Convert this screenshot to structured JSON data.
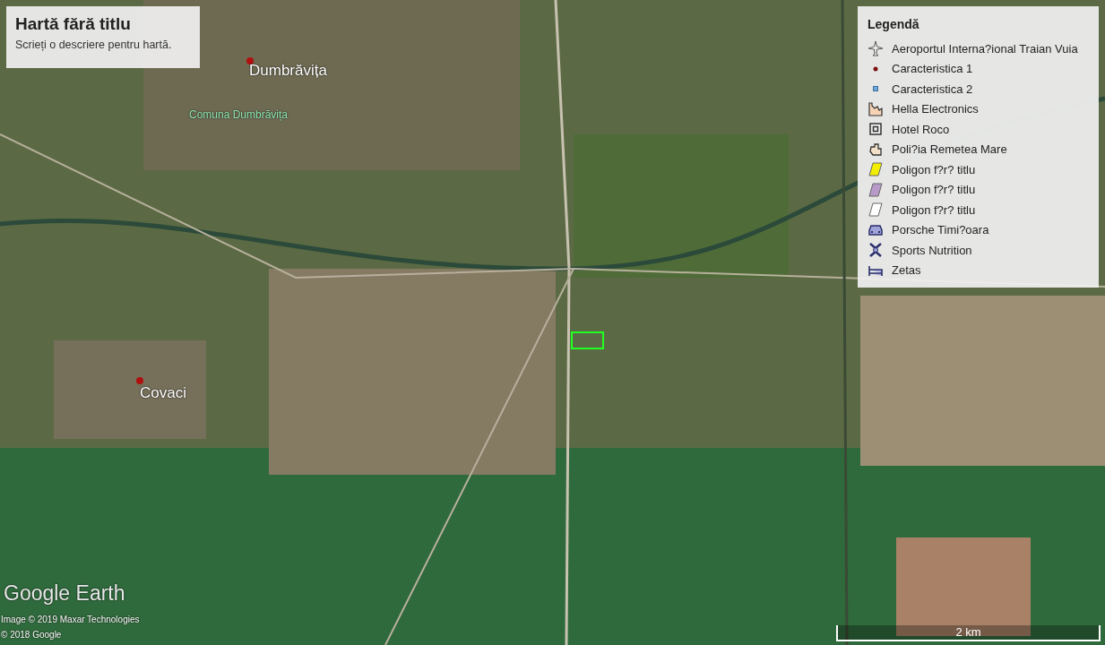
{
  "header": {
    "title": "Hartă fără titlu",
    "description": "Scrieți o descriere pentru hartă."
  },
  "map_labels": [
    {
      "kind": "place",
      "text": "Dumbrăvița"
    },
    {
      "kind": "area",
      "text": "Comuna Dumbrăvița"
    },
    {
      "kind": "place",
      "text": "Covaci"
    }
  ],
  "legend": {
    "title": "Legendă",
    "items": [
      {
        "kind": "plane",
        "label": "Aeroportul Interna?ional Traian Vuia"
      },
      {
        "kind": "dot",
        "label": "Caracteristica 1",
        "color": "#7a1010"
      },
      {
        "kind": "square",
        "label": "Caracteristica 2",
        "color": "#6fa7d8"
      },
      {
        "kind": "factory",
        "label": "Hella Electronics"
      },
      {
        "kind": "hotel",
        "label": "Hotel Roco"
      },
      {
        "kind": "police",
        "label": "Poli?ia Remetea Mare"
      },
      {
        "kind": "polygon",
        "label": "Poligon f?r? titlu",
        "color": "#f2ee00"
      },
      {
        "kind": "polygon",
        "label": "Poligon f?r? titlu",
        "color": "#b89ac8"
      },
      {
        "kind": "polygon",
        "label": "Poligon f?r? titlu",
        "color": "#ffffff"
      },
      {
        "kind": "car",
        "label": "Porsche Timi?oara"
      },
      {
        "kind": "gym",
        "label": "Sports Nutrition"
      },
      {
        "kind": "bed",
        "label": "Zetas"
      }
    ]
  },
  "brand": "Google Earth",
  "attribution": [
    "Image © 2019 Maxar Technologies",
    "© 2018 Google"
  ],
  "scale": "2 km"
}
